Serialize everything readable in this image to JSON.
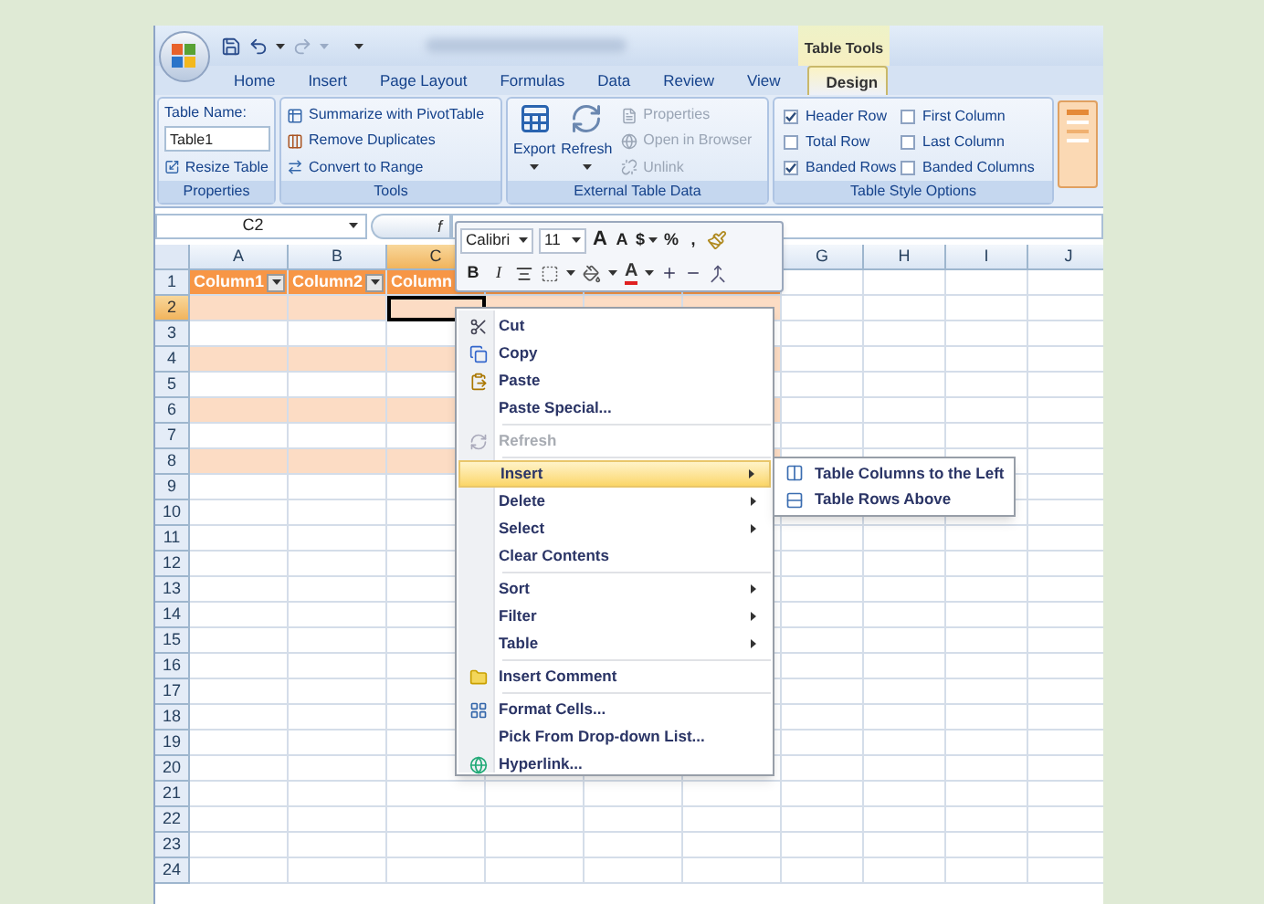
{
  "title_bar": {
    "contextual_group": "Table Tools"
  },
  "tabs": [
    {
      "label": "Home",
      "selected": false
    },
    {
      "label": "Insert",
      "selected": false
    },
    {
      "label": "Page Layout",
      "selected": false
    },
    {
      "label": "Formulas",
      "selected": false
    },
    {
      "label": "Data",
      "selected": false
    },
    {
      "label": "Review",
      "selected": false
    },
    {
      "label": "View",
      "selected": false
    },
    {
      "label": "Design",
      "selected": true
    }
  ],
  "properties_group": {
    "label": "Properties",
    "table_name_label": "Table Name:",
    "table_name": "Table1",
    "resize_button": "Resize Table"
  },
  "tools_group": {
    "label": "Tools",
    "buttons": [
      "Summarize with PivotTable",
      "Remove Duplicates",
      "Convert to Range"
    ]
  },
  "external_group": {
    "label": "External Table Data",
    "large_buttons": [
      "Export",
      "Refresh"
    ],
    "small_buttons": [
      {
        "label": "Properties",
        "disabled": true
      },
      {
        "label": "Open in Browser",
        "disabled": true
      },
      {
        "label": "Unlink",
        "disabled": true
      }
    ]
  },
  "style_options_group": {
    "label": "Table Style Options",
    "options": [
      {
        "label": "Header Row",
        "checked": true
      },
      {
        "label": "Total Row",
        "checked": false
      },
      {
        "label": "Banded Rows",
        "checked": true
      },
      {
        "label": "First Column",
        "checked": false
      },
      {
        "label": "Last Column",
        "checked": false
      },
      {
        "label": "Banded Columns",
        "checked": false
      }
    ]
  },
  "formula_bar": {
    "name_box": "C2",
    "function_button": "f"
  },
  "sheet": {
    "columns": [
      {
        "label": "A",
        "in_table": true,
        "selected": false
      },
      {
        "label": "B",
        "in_table": true,
        "selected": false
      },
      {
        "label": "C",
        "in_table": true,
        "selected": true
      },
      {
        "in_table": true
      },
      {
        "in_table": true
      },
      {
        "in_table": true
      },
      {
        "label": "G",
        "in_table": false,
        "selected": false
      },
      {
        "label": "H",
        "in_table": false,
        "selected": false
      },
      {
        "label": "I",
        "in_table": false,
        "selected": false
      },
      {
        "label": "J",
        "in_table": false,
        "selected": false
      }
    ],
    "header_cells": [
      {
        "text": "Column1",
        "filter_button": true
      },
      {
        "text": "Column2",
        "filter_button": true
      },
      {
        "text": "Column"
      }
    ],
    "rows": [
      {
        "label": "1",
        "selected": false
      },
      {
        "label": "2",
        "banded": true,
        "selected": true
      },
      {
        "label": "3",
        "banded": false,
        "selected": false
      },
      {
        "label": "4",
        "banded": true,
        "selected": false
      },
      {
        "label": "5",
        "banded": false,
        "selected": false
      },
      {
        "label": "6",
        "banded": true,
        "selected": false
      },
      {
        "label": "7",
        "banded": false,
        "selected": false
      },
      {
        "label": "8",
        "banded": true,
        "selected": false
      },
      {
        "label": "9",
        "banded": false,
        "selected": false
      },
      {
        "label": "10",
        "banded": false,
        "selected": false
      },
      {
        "label": "11",
        "banded": false,
        "selected": false
      },
      {
        "label": "12",
        "banded": false,
        "selected": false
      },
      {
        "label": "13",
        "banded": false,
        "selected": false
      },
      {
        "label": "14",
        "banded": false,
        "selected": false
      },
      {
        "label": "15",
        "banded": false,
        "selected": false
      },
      {
        "label": "16",
        "banded": false,
        "selected": false
      },
      {
        "label": "17",
        "banded": false,
        "selected": false
      },
      {
        "label": "18",
        "banded": false,
        "selected": false
      },
      {
        "label": "19",
        "banded": false,
        "selected": false
      },
      {
        "label": "20",
        "banded": false,
        "selected": false
      },
      {
        "label": "21",
        "banded": false,
        "selected": false
      },
      {
        "label": "22",
        "banded": false,
        "selected": false
      },
      {
        "label": "23",
        "banded": false,
        "selected": false
      },
      {
        "label": "24",
        "banded": false,
        "selected": false
      }
    ]
  },
  "mini_toolbar": {
    "font": "Calibri",
    "size": "11",
    "row1_buttons": [
      {
        "text": "A",
        "dropdown": false
      },
      {
        "text": "A",
        "dropdown": false
      },
      {
        "text": "$",
        "dropdown": true
      },
      {
        "text": "%",
        "dropdown": false
      },
      {
        "text": ",",
        "dropdown": false
      }
    ],
    "row2_buttons": [
      {
        "text": "B"
      },
      {
        "text": "I"
      }
    ],
    "font_color_button": "A"
  },
  "context_menu": {
    "items": [
      {
        "kind": "command",
        "label": "Cut",
        "disabled": false,
        "selected": false,
        "submenu": false
      },
      {
        "kind": "command",
        "label": "Copy",
        "disabled": false,
        "selected": false,
        "submenu": false
      },
      {
        "kind": "command",
        "label": "Paste",
        "disabled": false,
        "selected": false,
        "submenu": false
      },
      {
        "kind": "command",
        "label": "Paste Special...",
        "disabled": false,
        "selected": false,
        "submenu": false
      },
      {
        "kind": "separator"
      },
      {
        "kind": "command",
        "label": "Refresh",
        "disabled": true,
        "selected": false,
        "submenu": false
      },
      {
        "kind": "separator"
      },
      {
        "kind": "command",
        "label": "Insert",
        "disabled": false,
        "selected": true,
        "submenu": true
      },
      {
        "kind": "command",
        "label": "Delete",
        "disabled": false,
        "selected": false,
        "submenu": true
      },
      {
        "kind": "command",
        "label": "Select",
        "disabled": false,
        "selected": false,
        "submenu": true
      },
      {
        "kind": "command",
        "label": "Clear Contents",
        "disabled": false,
        "selected": false,
        "submenu": false
      },
      {
        "kind": "separator"
      },
      {
        "kind": "command",
        "label": "Sort",
        "disabled": false,
        "selected": false,
        "submenu": true
      },
      {
        "kind": "command",
        "label": "Filter",
        "disabled": false,
        "selected": false,
        "submenu": true
      },
      {
        "kind": "command",
        "label": "Table",
        "disabled": false,
        "selected": false,
        "submenu": true
      },
      {
        "kind": "separator"
      },
      {
        "kind": "command",
        "label": "Insert Comment",
        "disabled": false,
        "selected": false,
        "submenu": false
      },
      {
        "kind": "separator"
      },
      {
        "kind": "command",
        "label": "Format Cells...",
        "disabled": false,
        "selected": false,
        "submenu": false
      },
      {
        "kind": "command",
        "label": "Pick From Drop-down List...",
        "disabled": false,
        "selected": false,
        "submenu": false
      },
      {
        "kind": "command",
        "label": "Hyperlink...",
        "disabled": false,
        "selected": false,
        "submenu": false
      }
    ]
  },
  "submenu": {
    "items": [
      "Table Columns to the Left",
      "Table Rows Above"
    ]
  }
}
